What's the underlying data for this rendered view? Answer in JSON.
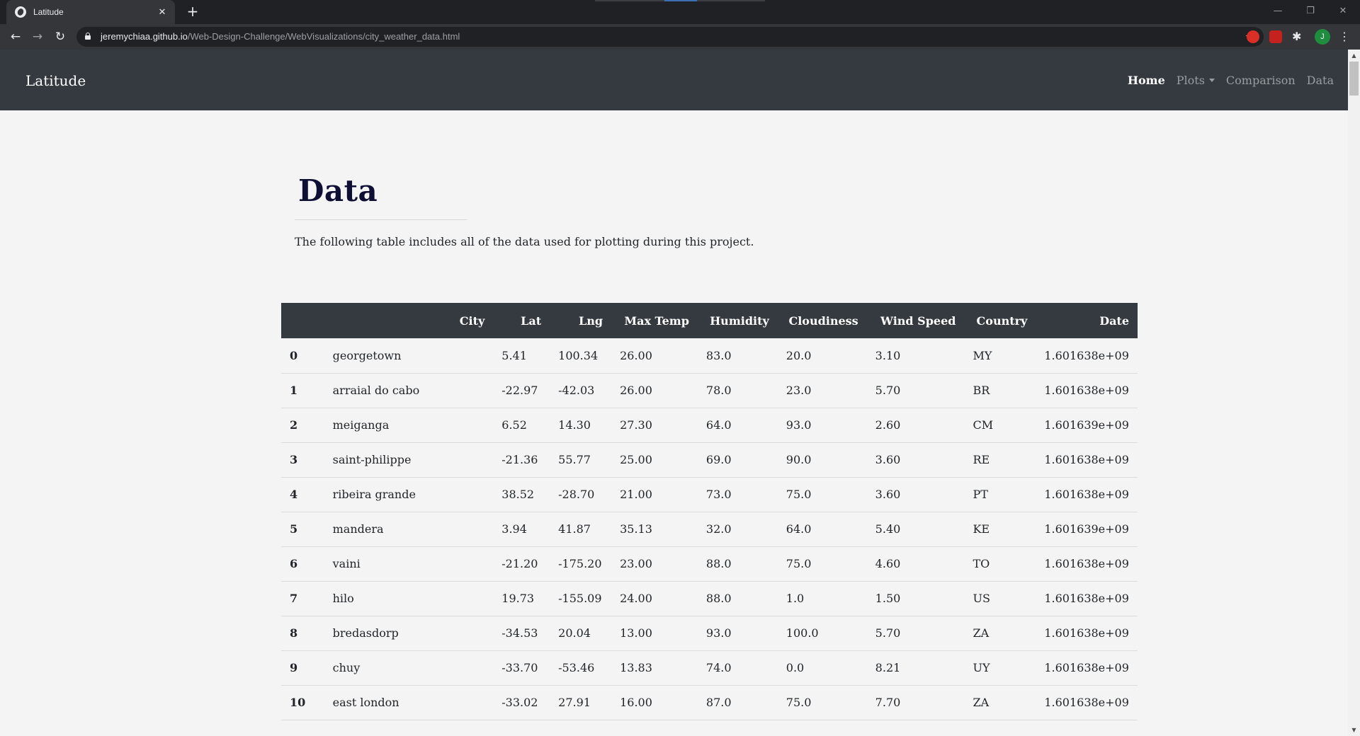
{
  "browser": {
    "tab_title": "Latitude",
    "url_host": "jeremychiaa.github.io",
    "url_path": "/Web-Design-Challenge/WebVisualizations/city_weather_data.html",
    "profile_initial": "J"
  },
  "nav": {
    "brand": "Latitude",
    "links": [
      "Home",
      "Plots",
      "Comparison",
      "Data"
    ]
  },
  "page": {
    "title": "Data",
    "intro": "The following table includes all of the data used for plotting during this project."
  },
  "table": {
    "headers": [
      "",
      "City",
      "Lat",
      "Lng",
      "Max Temp",
      "Humidity",
      "Cloudiness",
      "Wind Speed",
      "Country",
      "Date"
    ],
    "rows": [
      [
        "0",
        "georgetown",
        "5.41",
        "100.34",
        "26.00",
        "83.0",
        "20.0",
        "3.10",
        "MY",
        "1.601638e+09"
      ],
      [
        "1",
        "arraial do cabo",
        "-22.97",
        "-42.03",
        "26.00",
        "78.0",
        "23.0",
        "5.70",
        "BR",
        "1.601638e+09"
      ],
      [
        "2",
        "meiganga",
        "6.52",
        "14.30",
        "27.30",
        "64.0",
        "93.0",
        "2.60",
        "CM",
        "1.601639e+09"
      ],
      [
        "3",
        "saint-philippe",
        "-21.36",
        "55.77",
        "25.00",
        "69.0",
        "90.0",
        "3.60",
        "RE",
        "1.601638e+09"
      ],
      [
        "4",
        "ribeira grande",
        "38.52",
        "-28.70",
        "21.00",
        "73.0",
        "75.0",
        "3.60",
        "PT",
        "1.601638e+09"
      ],
      [
        "5",
        "mandera",
        "3.94",
        "41.87",
        "35.13",
        "32.0",
        "64.0",
        "5.40",
        "KE",
        "1.601639e+09"
      ],
      [
        "6",
        "vaini",
        "-21.20",
        "-175.20",
        "23.00",
        "88.0",
        "75.0",
        "4.60",
        "TO",
        "1.601638e+09"
      ],
      [
        "7",
        "hilo",
        "19.73",
        "-155.09",
        "24.00",
        "88.0",
        "1.0",
        "1.50",
        "US",
        "1.601638e+09"
      ],
      [
        "8",
        "bredasdorp",
        "-34.53",
        "20.04",
        "13.00",
        "93.0",
        "100.0",
        "5.70",
        "ZA",
        "1.601638e+09"
      ],
      [
        "9",
        "chuy",
        "-33.70",
        "-53.46",
        "13.83",
        "74.0",
        "0.0",
        "8.21",
        "UY",
        "1.601638e+09"
      ],
      [
        "10",
        "east london",
        "-33.02",
        "27.91",
        "16.00",
        "87.0",
        "75.0",
        "7.70",
        "ZA",
        "1.601638e+09"
      ]
    ]
  }
}
